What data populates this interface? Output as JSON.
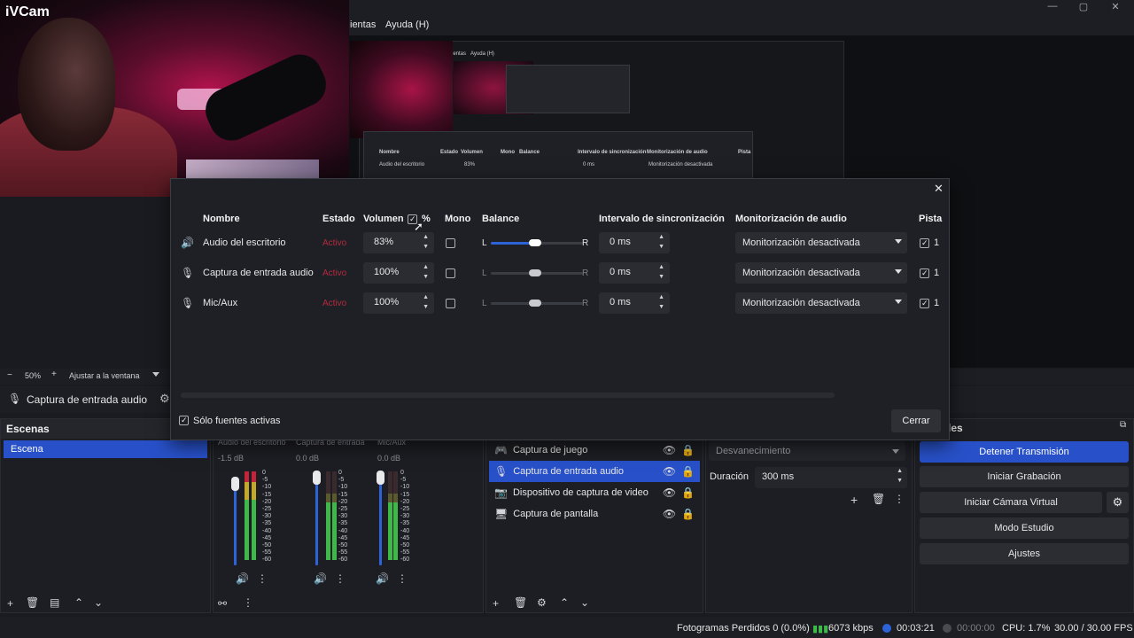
{
  "window": {
    "minimize": "—",
    "maximize": "▢",
    "close": "✕"
  },
  "menu": {
    "item_tools_partial": "ientas",
    "item_help": "Ayuda (H)"
  },
  "webcam": {
    "label": "iVCam"
  },
  "preview_mini": {
    "menu_partial": "ientas",
    "menu_help": "Ayuda (H)",
    "headers": [
      "Nombre",
      "Estado",
      "Volumen",
      "%",
      "Mono",
      "Balance",
      "Intervalo de sincronización",
      "Monitorización de audio",
      "Pista"
    ],
    "row_name": "Audio del escritorio",
    "row_vol": "83%",
    "row_sync": "0 ms",
    "row_mon": "Monitorización desactivada"
  },
  "context_bar": {
    "zoom": "50%",
    "fit": "Ajustar a la ventana"
  },
  "source_bar": {
    "label": "Captura de entrada audio"
  },
  "scenes": {
    "title": "Escenas",
    "items": [
      "Escena"
    ]
  },
  "mixer": {
    "channels": [
      {
        "name": "Audio del escritorio",
        "db": "-1.5 dB"
      },
      {
        "name": "Captura de entrada",
        "db": "0.0 dB"
      },
      {
        "name": "Mic/Aux",
        "db": "0.0 dB"
      }
    ],
    "ticks": [
      "0",
      "-5",
      "-10",
      "-15",
      "-20",
      "-25",
      "-30",
      "-35",
      "-40",
      "-45",
      "-50",
      "-55",
      "-60"
    ]
  },
  "sources": {
    "items": [
      {
        "label": "Captura de juego",
        "selected": false
      },
      {
        "label": "Captura de entrada audio",
        "selected": true
      },
      {
        "label": "Dispositivo de captura de video",
        "selected": false
      },
      {
        "label": "Captura de pantalla",
        "selected": false
      }
    ]
  },
  "transitions": {
    "type": "Desvanecimiento",
    "duration_label": "Duración",
    "duration_value": "300 ms"
  },
  "controls": {
    "title_partial": "les",
    "stop_stream": "Detener Transmisión",
    "start_record": "Iniciar Grabación",
    "start_virtual_cam": "Iniciar Cámara Virtual",
    "studio_mode": "Modo Estudio",
    "settings": "Ajustes"
  },
  "status": {
    "dropped_frames": "Fotogramas Perdidos 0 (0.0%)",
    "bitrate": "6073 kbps",
    "stream_time": "00:03:21",
    "record_time": "00:00:00",
    "cpu": "CPU: 1.7%",
    "fps": "30.00 / 30.00 FPS"
  },
  "dialog": {
    "close": "✕",
    "headers": {
      "name": "Nombre",
      "status": "Estado",
      "volume": "Volumen",
      "percent": "%",
      "mono": "Mono",
      "balance": "Balance",
      "sync": "Intervalo de sincronización",
      "monitoring": "Monitorización de audio",
      "tracks": "Pista"
    },
    "rows": [
      {
        "name": "Audio del escritorio",
        "status": "Activo",
        "volume": "83%",
        "sync": "0 ms",
        "monitoring": "Monitorización desactivada",
        "track": "1",
        "balance_L": "L",
        "balance_R": "R"
      },
      {
        "name": "Captura de entrada audio",
        "status": "Activo",
        "volume": "100%",
        "sync": "0 ms",
        "monitoring": "Monitorización desactivada",
        "track": "1",
        "balance_L": "L",
        "balance_R": "R"
      },
      {
        "name": "Mic/Aux",
        "status": "Activo",
        "volume": "100%",
        "sync": "0 ms",
        "monitoring": "Monitorización desactivada",
        "track": "1",
        "balance_L": "L",
        "balance_R": "R"
      }
    ],
    "active_only": "Sólo fuentes activas",
    "close_button": "Cerrar"
  }
}
